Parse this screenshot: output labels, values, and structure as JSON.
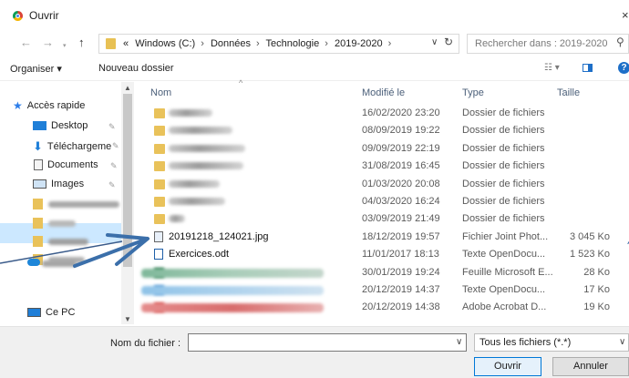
{
  "window": {
    "title": "Ouvrir",
    "close_glyph": "×"
  },
  "nav_buttons": {
    "back": "←",
    "forward": "→",
    "up": "↑"
  },
  "address": {
    "prefix": "«",
    "crumbs": [
      "Windows (C:)",
      "Données",
      "Technologie",
      "2019-2020"
    ],
    "separator": "›"
  },
  "search": {
    "placeholder": "Rechercher dans : 2019-2020"
  },
  "toolbar": {
    "organiser": "Organiser ▾",
    "nouveau_dossier": "Nouveau dossier",
    "help": "?"
  },
  "sidebar": {
    "items": [
      {
        "label": "Accès rapide",
        "icon": "star-icon",
        "pinned": false
      },
      {
        "label": "Desktop",
        "icon": "desktop-icon",
        "pinned": true
      },
      {
        "label": "Téléchargeme",
        "icon": "download-icon",
        "pinned": true
      },
      {
        "label": "Documents",
        "icon": "documents-icon",
        "pinned": true
      },
      {
        "label": "Images",
        "icon": "images-icon",
        "pinned": true
      },
      {
        "label": "Ce PC",
        "icon": "pc-icon",
        "pinned": false
      }
    ]
  },
  "columns": {
    "name": "Nom",
    "modified": "Modifié le",
    "type": "Type",
    "size": "Taille"
  },
  "files": [
    {
      "name": "",
      "date": "16/02/2020 23:20",
      "type": "Dossier de fichiers",
      "size": "",
      "kind": "folder",
      "blur_w": 48
    },
    {
      "name": "",
      "date": "08/09/2019 19:22",
      "type": "Dossier de fichiers",
      "size": "",
      "kind": "folder",
      "blur_w": 70
    },
    {
      "name": "",
      "date": "09/09/2019 22:19",
      "type": "Dossier de fichiers",
      "size": "",
      "kind": "folder",
      "blur_w": 84
    },
    {
      "name": "",
      "date": "31/08/2019 16:45",
      "type": "Dossier de fichiers",
      "size": "",
      "kind": "folder",
      "blur_w": 82
    },
    {
      "name": "",
      "date": "01/03/2020 20:08",
      "type": "Dossier de fichiers",
      "size": "",
      "kind": "folder",
      "blur_w": 56
    },
    {
      "name": "",
      "date": "04/03/2020 16:24",
      "type": "Dossier de fichiers",
      "size": "",
      "kind": "folder",
      "blur_w": 62
    },
    {
      "name": "",
      "date": "03/09/2019 21:49",
      "type": "Dossier de fichiers",
      "size": "",
      "kind": "folder",
      "blur_w": 18
    },
    {
      "name": "20191218_124021.jpg",
      "date": "18/12/2019 19:57",
      "type": "Fichier Joint Phot...",
      "size": "3 045 Ko",
      "kind": "jpg"
    },
    {
      "name": "Exercices.odt",
      "date": "11/01/2017 18:13",
      "type": "Texte OpenDocu...",
      "size": "1 523 Ko",
      "kind": "odt"
    },
    {
      "name": "",
      "date": "30/01/2019 19:24",
      "type": "Feuille Microsoft E...",
      "size": "28 Ko",
      "kind": "xlsx"
    },
    {
      "name": "",
      "date": "20/12/2019 14:37",
      "type": "Texte OpenDocu...",
      "size": "17 Ko",
      "kind": "odt-blur"
    },
    {
      "name": "",
      "date": "20/12/2019 14:38",
      "type": "Adobe Acrobat D...",
      "size": "19 Ko",
      "kind": "pdf"
    }
  ],
  "footer": {
    "filename_label": "Nom du fichier :",
    "filename_value": "",
    "filter": "Tous les fichiers (*.*)",
    "open": "Ouvrir",
    "cancel": "Annuler"
  }
}
